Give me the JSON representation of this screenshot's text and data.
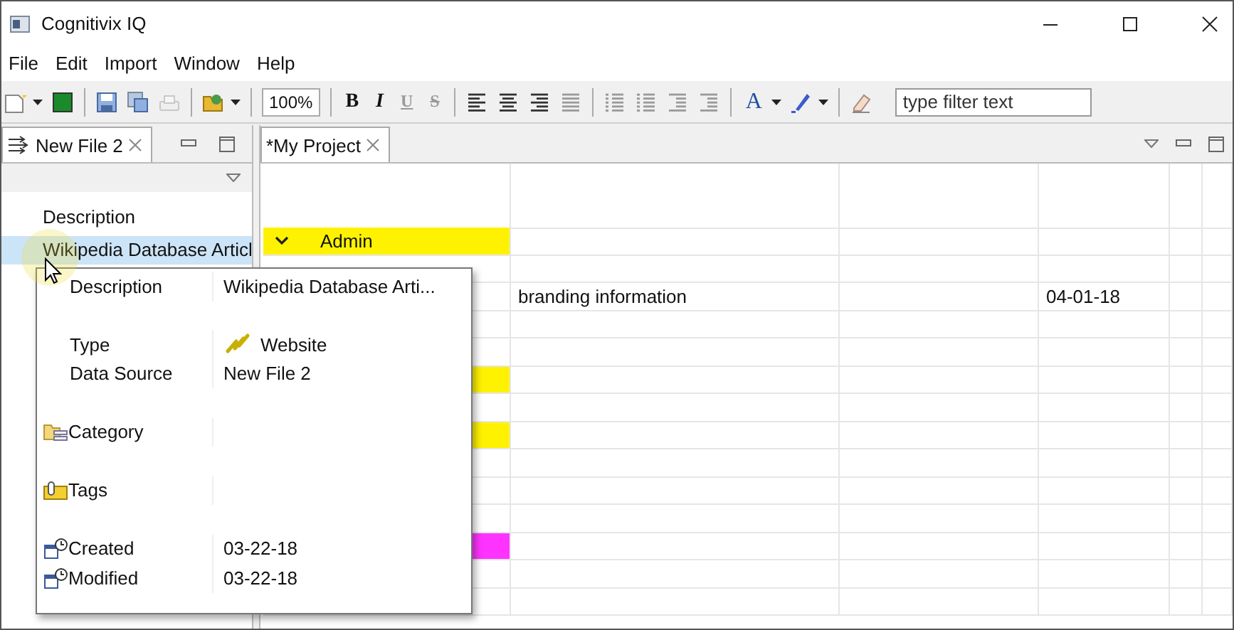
{
  "window": {
    "title": "Cognitivix IQ"
  },
  "menu": [
    "File",
    "Edit",
    "Import",
    "Window",
    "Help"
  ],
  "toolbar": [
    {
      "kind": "new",
      "dropdown": true,
      "disabled": false
    },
    {
      "kind": "stop",
      "disabled": false
    },
    {
      "kind": "sep"
    },
    {
      "kind": "save",
      "disabled": false
    },
    {
      "kind": "saveall",
      "disabled": false
    },
    {
      "kind": "print",
      "disabled": true
    },
    {
      "kind": "sep"
    },
    {
      "kind": "open",
      "dropdown": true,
      "disabled": false
    },
    {
      "kind": "sep"
    },
    {
      "kind": "zoom",
      "value": "100%"
    },
    {
      "kind": "sep"
    },
    {
      "kind": "bold",
      "label": "B",
      "disabled": false
    },
    {
      "kind": "italic",
      "label": "I",
      "disabled": false
    },
    {
      "kind": "underline",
      "label": "U",
      "disabled": true
    },
    {
      "kind": "strike",
      "label": "S",
      "disabled": true
    },
    {
      "kind": "sep"
    },
    {
      "kind": "alignleft",
      "disabled": false
    },
    {
      "kind": "aligncenter",
      "disabled": false
    },
    {
      "kind": "alignright",
      "disabled": false
    },
    {
      "kind": "justify",
      "disabled": true
    },
    {
      "kind": "sep"
    },
    {
      "kind": "numlist",
      "disabled": true
    },
    {
      "kind": "bullets",
      "disabled": true
    },
    {
      "kind": "outdent",
      "disabled": true
    },
    {
      "kind": "indent",
      "disabled": true
    },
    {
      "kind": "sep"
    },
    {
      "kind": "fontcolor",
      "label": "A",
      "dropdown": true,
      "disabled": false
    },
    {
      "kind": "pen",
      "dropdown": true,
      "disabled": false
    },
    {
      "kind": "sep"
    },
    {
      "kind": "eraser",
      "disabled": false
    },
    {
      "kind": "filter",
      "placeholder": "type filter text"
    }
  ],
  "left_panel": {
    "tab": {
      "label": "New File 2",
      "selected": true
    },
    "items": [
      {
        "label": "Description",
        "selected": false
      },
      {
        "label": "Wikipedia Database Articl",
        "selected": true
      }
    ]
  },
  "right_panel": {
    "tab": {
      "label": "*My Project",
      "selected": true
    },
    "rows": [
      {
        "color": "#fff200",
        "column_1": "Admin",
        "expanded": true
      },
      {},
      {
        "column_2": "branding information",
        "column_4": "04-01-18"
      },
      {},
      {},
      {
        "color": "#fff200"
      },
      {},
      {
        "color": "#fff200"
      },
      {},
      {},
      {},
      {
        "color": "#ff33ff"
      },
      {},
      {}
    ]
  },
  "tooltip": {
    "sections": [
      [
        {
          "kind": "plain",
          "label": "Description",
          "value": "Wikipedia Database Arti..."
        }
      ],
      [
        {
          "kind": "link",
          "label": "Type",
          "value": "Website"
        },
        {
          "kind": "plain",
          "label": "Data Source",
          "value": "New File 2"
        }
      ],
      [
        {
          "kind": "category",
          "label": "Category"
        }
      ],
      [
        {
          "kind": "tags",
          "label": "Tags"
        }
      ],
      [
        {
          "kind": "date",
          "label": "Created",
          "value": "03-22-18"
        },
        {
          "kind": "date",
          "label": "Modified",
          "value": "03-22-18"
        }
      ]
    ]
  }
}
